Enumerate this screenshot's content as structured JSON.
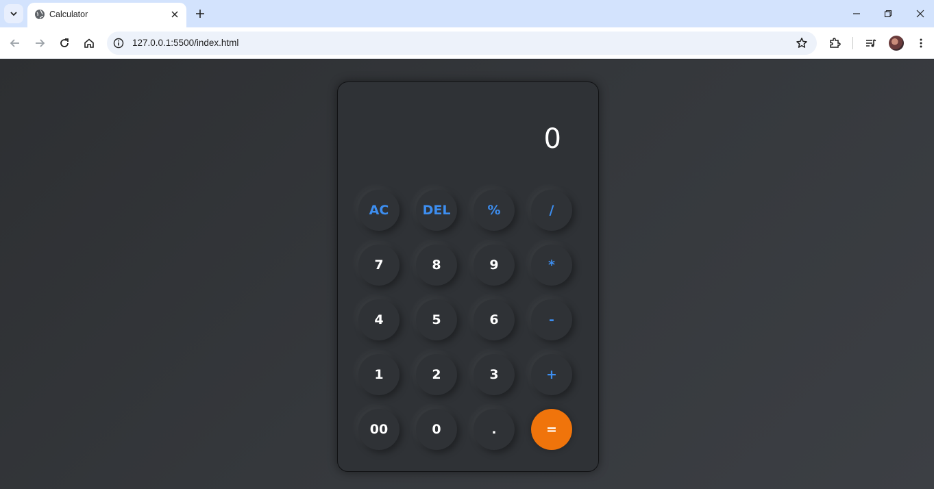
{
  "browser": {
    "tab_title": "Calculator",
    "url": "127.0.0.1:5500/index.html"
  },
  "calculator": {
    "display": "0",
    "rows": [
      [
        {
          "label": "AC",
          "kind": "op"
        },
        {
          "label": "DEL",
          "kind": "op"
        },
        {
          "label": "%",
          "kind": "op"
        },
        {
          "label": "/",
          "kind": "op"
        }
      ],
      [
        {
          "label": "7",
          "kind": "num"
        },
        {
          "label": "8",
          "kind": "num"
        },
        {
          "label": "9",
          "kind": "num"
        },
        {
          "label": "*",
          "kind": "op"
        }
      ],
      [
        {
          "label": "4",
          "kind": "num"
        },
        {
          "label": "5",
          "kind": "num"
        },
        {
          "label": "6",
          "kind": "num"
        },
        {
          "label": "-",
          "kind": "op"
        }
      ],
      [
        {
          "label": "1",
          "kind": "num"
        },
        {
          "label": "2",
          "kind": "num"
        },
        {
          "label": "3",
          "kind": "num"
        },
        {
          "label": "+",
          "kind": "op"
        }
      ],
      [
        {
          "label": "00",
          "kind": "num"
        },
        {
          "label": "0",
          "kind": "num"
        },
        {
          "label": ".",
          "kind": "num"
        },
        {
          "label": "=",
          "kind": "eq"
        }
      ]
    ]
  },
  "colors": {
    "operator": "#3d8ef0",
    "equals": "#f0740b",
    "background": "#2f3236"
  }
}
